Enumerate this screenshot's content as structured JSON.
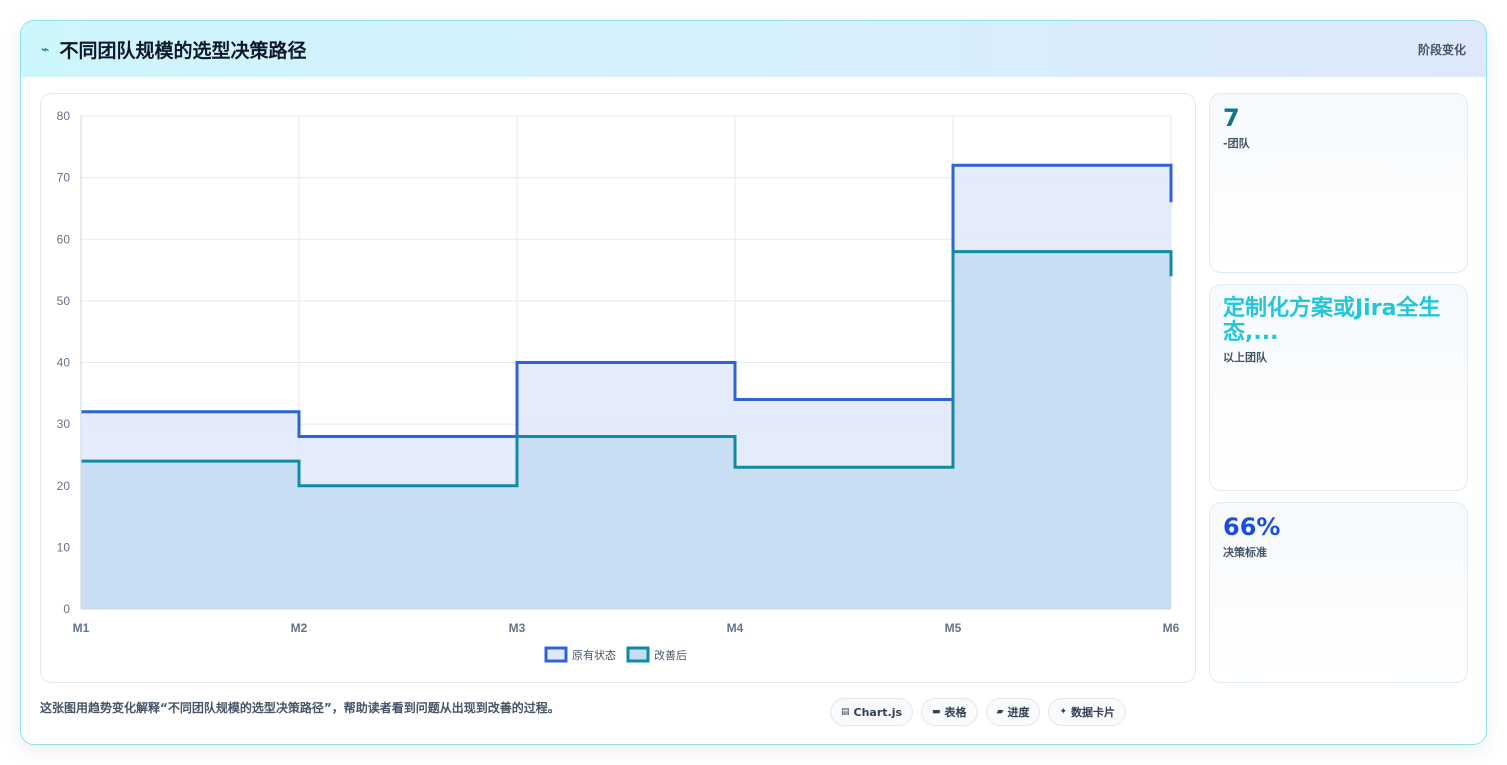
{
  "header": {
    "icon": "⌁",
    "title": "不同团队规模的选型决策路径",
    "tag": "阶段变化"
  },
  "stats": [
    {
      "value": "7",
      "label": "-团队",
      "color": "#0e7490"
    },
    {
      "value": "定制化方案或Jira全生态,...",
      "label": "以上团队",
      "color": "#22c5d9"
    },
    {
      "value": "66%",
      "label": "决策标准",
      "color": "#1d4ed8"
    }
  ],
  "footer": {
    "caption": "这张图用趋势变化解释“不同团队规模的选型决策路径”，帮助读者看到问题从出现到改善的过程。",
    "chips": [
      {
        "icon": "▤",
        "label": "Chart.js"
      },
      {
        "icon": "▬",
        "label": "表格"
      },
      {
        "icon": "▰",
        "label": "进度"
      },
      {
        "icon": "✦",
        "label": "数据卡片"
      }
    ]
  },
  "chart_data": {
    "type": "line",
    "stepped": true,
    "x": [
      "M1",
      "M2",
      "M3",
      "M4",
      "M5",
      "M6"
    ],
    "ylim": [
      0,
      80
    ],
    "yticks": [
      0,
      10,
      20,
      30,
      40,
      50,
      60,
      70,
      80
    ],
    "grid": true,
    "legend_position": "bottom",
    "series": [
      {
        "name": "原有状态",
        "values": [
          32,
          28,
          40,
          34,
          72,
          66
        ],
        "color": "#2f63d6",
        "fill": "#dfe8fa"
      },
      {
        "name": "改善后",
        "values": [
          24,
          20,
          28,
          23,
          58,
          54
        ],
        "color": "#118aa3",
        "fill": "#c5dcf1"
      }
    ]
  }
}
